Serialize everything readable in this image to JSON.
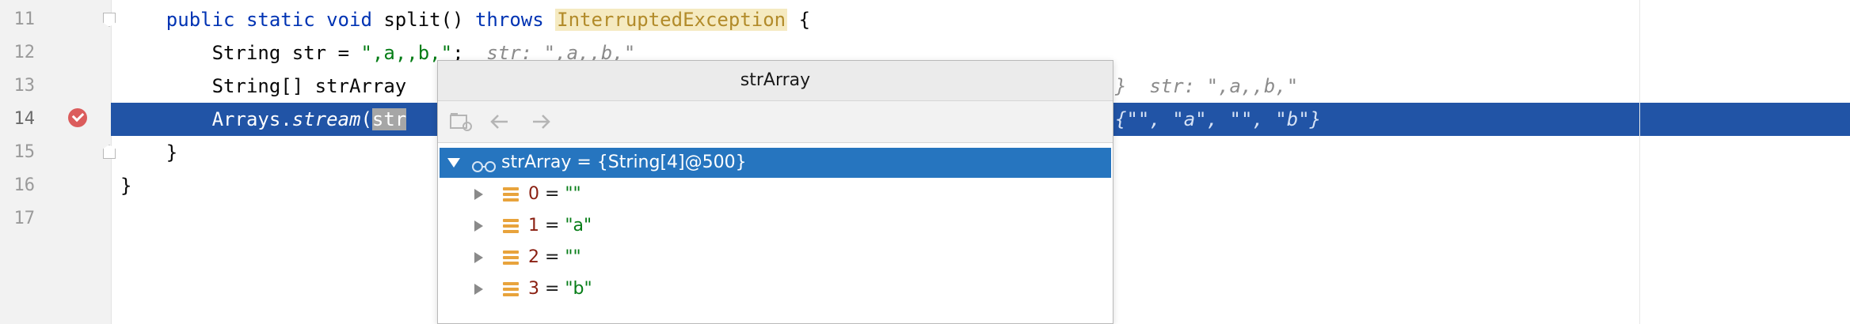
{
  "editor": {
    "line_numbers": [
      "11",
      "12",
      "13",
      "14",
      "15",
      "16",
      "17"
    ],
    "lines": {
      "l11": {
        "indent": "    ",
        "kw1": "public",
        "kw2": "static",
        "kw3": "void",
        "method": "split()",
        "kw4": "throws",
        "exception": "InterruptedException",
        "brace": "{"
      },
      "l12": {
        "indent": "        ",
        "type": "String",
        "var": "str",
        "eq": "=",
        "value": "\",a,,b,\"",
        "semi": ";",
        "hint": "str: \",a,,b,\""
      },
      "l13": {
        "indent": "        ",
        "text": "String[] strArray",
        "hint_tail": "}  str: \",a,,b,\""
      },
      "l14": {
        "indent": "        ",
        "text": "Arrays.",
        "method": "stream",
        "paren": "(",
        "partial": "str",
        "hint_tail": "{\"\", \"a\", \"\", \"b\"}"
      },
      "l15": {
        "text": "    }"
      },
      "l16": {
        "text": "}"
      }
    }
  },
  "popup": {
    "title": "strArray",
    "root": {
      "label": "strArray = {String[4]@500}"
    },
    "items": [
      {
        "index": "0",
        "eq": " = ",
        "value": "\"\""
      },
      {
        "index": "1",
        "eq": " = ",
        "value": "\"a\""
      },
      {
        "index": "2",
        "eq": " = ",
        "value": "\"\""
      },
      {
        "index": "3",
        "eq": " = ",
        "value": "\"b\""
      }
    ]
  },
  "colors": {
    "exec_line": "#2154a6",
    "tree_selected": "#2675bf",
    "keyword": "#0033b3",
    "string": "#067d17"
  }
}
